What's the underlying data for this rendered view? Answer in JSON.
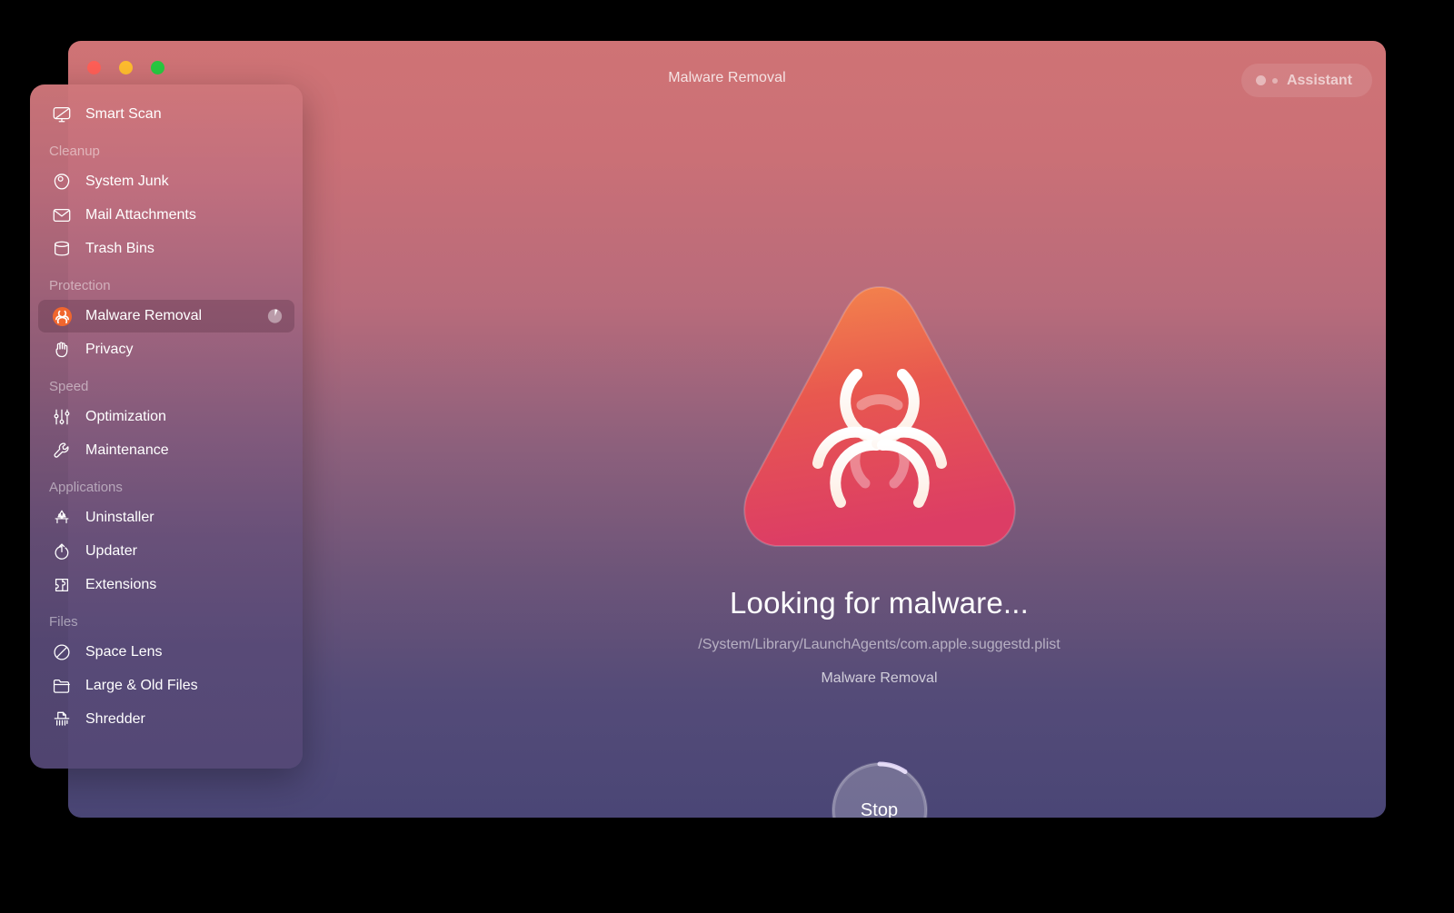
{
  "window": {
    "title": "Malware Removal",
    "traffic_lights": [
      "close",
      "minimize",
      "zoom"
    ],
    "assistant_label": "Assistant"
  },
  "sidebar": {
    "top_items": [
      {
        "label": "Smart Scan",
        "icon": "smart-scan-icon"
      }
    ],
    "sections": [
      {
        "title": "Cleanup",
        "items": [
          {
            "label": "System Junk",
            "icon": "system-junk-icon"
          },
          {
            "label": "Mail Attachments",
            "icon": "mail-attachments-icon"
          },
          {
            "label": "Trash Bins",
            "icon": "trash-bins-icon"
          }
        ]
      },
      {
        "title": "Protection",
        "items": [
          {
            "label": "Malware Removal",
            "icon": "biohazard-icon",
            "selected": true,
            "progress": 8
          },
          {
            "label": "Privacy",
            "icon": "privacy-hand-icon"
          }
        ]
      },
      {
        "title": "Speed",
        "items": [
          {
            "label": "Optimization",
            "icon": "sliders-icon"
          },
          {
            "label": "Maintenance",
            "icon": "wrench-icon"
          }
        ]
      },
      {
        "title": "Applications",
        "items": [
          {
            "label": "Uninstaller",
            "icon": "uninstaller-icon"
          },
          {
            "label": "Updater",
            "icon": "updater-icon"
          },
          {
            "label": "Extensions",
            "icon": "extensions-puzzle-icon"
          }
        ]
      },
      {
        "title": "Files",
        "items": [
          {
            "label": "Space Lens",
            "icon": "space-lens-icon"
          },
          {
            "label": "Large & Old Files",
            "icon": "folder-icon"
          },
          {
            "label": "Shredder",
            "icon": "shredder-icon"
          }
        ]
      }
    ]
  },
  "main": {
    "hero_icon": "biohazard-triangle-icon",
    "status_title": "Looking for malware...",
    "status_path": "/System/Library/LaunchAgents/com.apple.suggestd.plist",
    "status_subtitle": "Malware Removal",
    "stop_button_label": "Stop",
    "progress_percent": 8
  },
  "colors": {
    "background_top": "#cf7375",
    "background_mid": "#8d607c",
    "background_bottom": "#4a4676",
    "hazard_top": "#f1814f",
    "hazard_bottom": "#dc3f63",
    "accent_progress": "#d9cdf2"
  }
}
